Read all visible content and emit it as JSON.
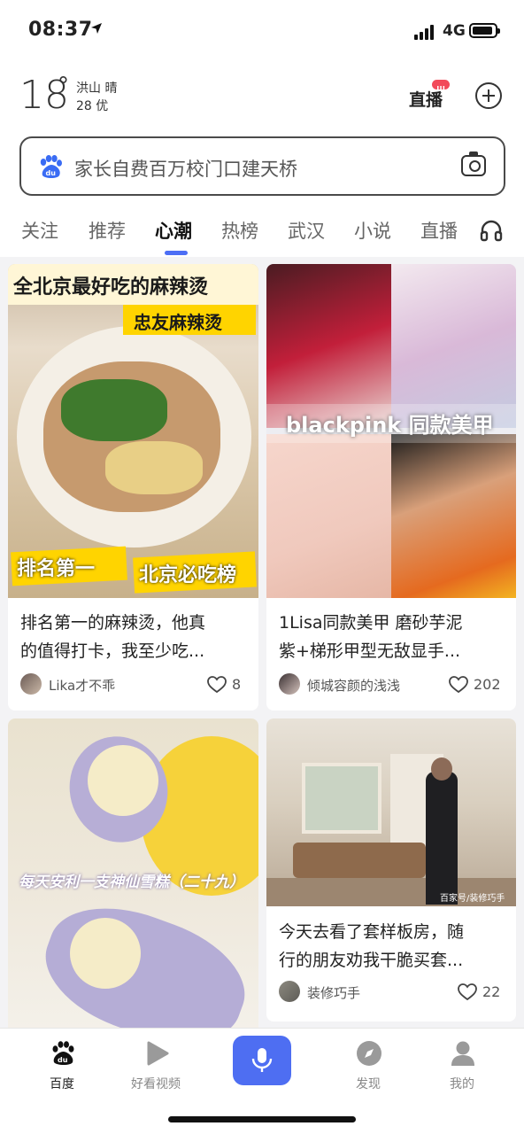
{
  "status": {
    "time": "08:37",
    "network": "4G"
  },
  "weather": {
    "temp": "18",
    "deg": "°",
    "city": "洪山 晴",
    "aqi": "28 优"
  },
  "header": {
    "live_label": "直播"
  },
  "search": {
    "placeholder": "家长自费百万校门口建天桥"
  },
  "tabs": [
    "关注",
    "推荐",
    "心潮",
    "热榜",
    "武汉",
    "小说",
    "直播"
  ],
  "active_tab": "心潮",
  "cards": [
    {
      "title_line1": "排名第一的麻辣烫，他真",
      "title_line2": "的值得打卡，我至少吃...",
      "author": "Lika才不乖",
      "likes": "8",
      "overlay_main": "全北京最好吃的麻辣烫",
      "overlay_sub": "忠友麻辣烫",
      "overlay_tag1": "排名第一",
      "overlay_tag2": "北京必吃榜"
    },
    {
      "title_line1": "1Lisa同款美甲 磨砂芋泥",
      "title_line2": "紫+梯形甲型无敌显手...",
      "author": "倾城容颜的浅浅",
      "likes": "202",
      "overlay_main": "blackpink 同款美甲"
    },
    {
      "overlay_main": "每天安利一支神仙雪糕（二十九）"
    },
    {
      "title_line1": "今天去看了套样板房，随",
      "title_line2": "行的朋友劝我干脆买套...",
      "author": "装修巧手",
      "likes": "22",
      "watermark": "百家号/装修巧手"
    }
  ],
  "bottom_nav": [
    {
      "label": "百度",
      "icon": "baidu-paw-icon"
    },
    {
      "label": "好看视频",
      "icon": "play-icon"
    },
    {
      "label": "",
      "icon": "mic-icon"
    },
    {
      "label": "发现",
      "icon": "compass-icon"
    },
    {
      "label": "我的",
      "icon": "user-icon"
    }
  ],
  "colors": {
    "accent": "#4e6ef2",
    "badge": "#f24a5a"
  }
}
